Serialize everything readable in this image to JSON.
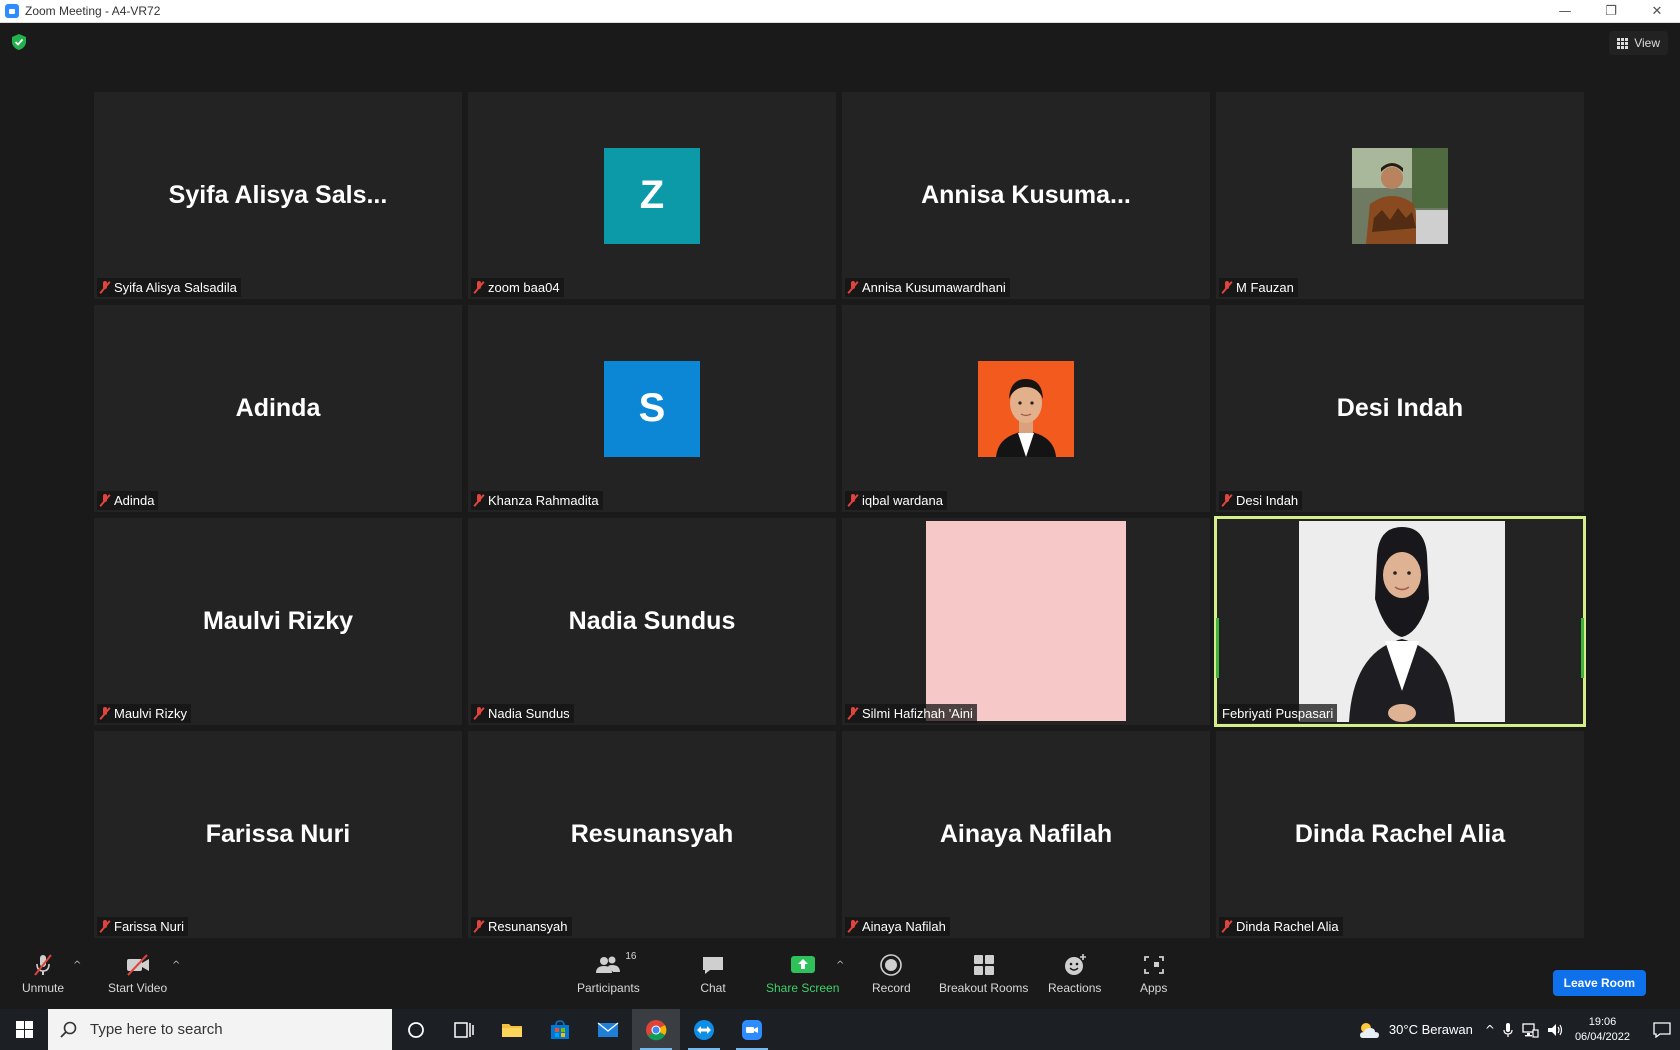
{
  "window": {
    "title": "Zoom Meeting - A4-VR72",
    "minimize": "—",
    "restore": "❐",
    "close": "✕"
  },
  "meeting": {
    "view_label": "View",
    "tiles": [
      {
        "display": "Syifa Alisya Sals...",
        "label": "Syifa Alisya Salsadila",
        "kind": "name"
      },
      {
        "display": "Z",
        "label": "zoom baa04",
        "kind": "letter",
        "color": "#0d9aa8"
      },
      {
        "display": "Annisa  Kusuma...",
        "label": "Annisa Kusumawardhani",
        "kind": "name"
      },
      {
        "display": "",
        "label": "M Fauzan",
        "kind": "photo-fauzan"
      },
      {
        "display": "Adinda",
        "label": "Adinda",
        "kind": "name"
      },
      {
        "display": "S",
        "label": "Khanza Rahmadita",
        "kind": "letter",
        "color": "#0b87d5"
      },
      {
        "display": "",
        "label": "iqbal wardana",
        "kind": "photo-iqbal"
      },
      {
        "display": "Desi Indah",
        "label": "Desi Indah",
        "kind": "name"
      },
      {
        "display": "Maulvi Rizky",
        "label": "Maulvi Rizky",
        "kind": "name"
      },
      {
        "display": "Nadia Sundus",
        "label": "Nadia Sundus",
        "kind": "name"
      },
      {
        "display": "",
        "label": "Silmi Hafizhah 'Aini",
        "kind": "video-pink"
      },
      {
        "display": "",
        "label": "Febriyati Puspasari",
        "kind": "video-febri"
      },
      {
        "display": "Farissa Nuri",
        "label": "Farissa Nuri",
        "kind": "name"
      },
      {
        "display": "Resunansyah",
        "label": "Resunansyah",
        "kind": "name"
      },
      {
        "display": "Ainaya Nafilah",
        "label": "Ainaya Nafilah",
        "kind": "name"
      },
      {
        "display": "Dinda Rachel Alia",
        "label": "Dinda Rachel Alia",
        "kind": "name"
      }
    ]
  },
  "toolbar": {
    "unmute": "Unmute",
    "start_video": "Start Video",
    "participants": "Participants",
    "participants_count": "16",
    "chat": "Chat",
    "share_screen": "Share Screen",
    "record": "Record",
    "breakout_rooms": "Breakout Rooms",
    "reactions": "Reactions",
    "apps": "Apps",
    "leave": "Leave Room",
    "caret": "^"
  },
  "taskbar": {
    "search_placeholder": "Type here to search",
    "weather": "30°C  Berawan",
    "time": "19:06",
    "date": "06/04/2022"
  },
  "colors": {
    "accent": "#0e71eb",
    "muted_red": "#e0443c",
    "share_green": "#3dd16a",
    "active_speaker": "#d4ee8a"
  }
}
